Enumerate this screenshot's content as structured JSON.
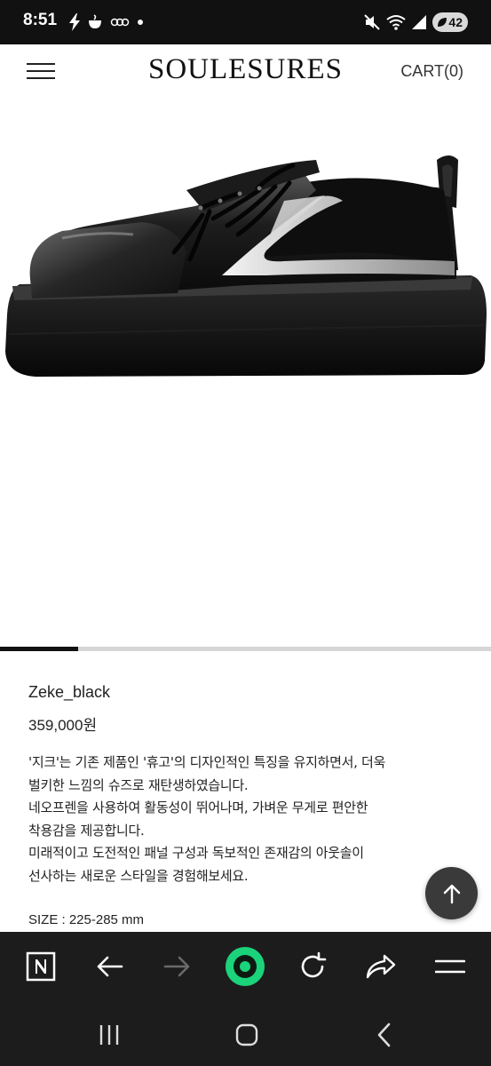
{
  "status_bar": {
    "time": "8:51",
    "battery": "42",
    "icons": [
      "bolt-icon",
      "teacup-icon",
      "link-icon",
      "dot-icon",
      "mute-icon",
      "wifi-icon",
      "signal-icon",
      "battery-icon"
    ]
  },
  "header": {
    "logo": "SOULESURES",
    "cart": "CART(0)",
    "menu_icon": "hamburger-menu-icon"
  },
  "gallery": {
    "image": "black platform shoe with silver wave accent",
    "position": 0.16
  },
  "product": {
    "name": "Zeke_black",
    "price": "359,000원",
    "description": [
      "'지크'는 기존 제품인 '휴고'의 디자인적인 특징을 유지하면서, 더욱",
      "벌키한 느낌의 슈즈로 재탄생하였습니다.",
      "네오프렌을 사용하여 활동성이 뛰어나며, 가벼운 무게로 편안한",
      "착용감을 제공합니다.",
      "미래적이고 도전적인 패널 구성과 독보적인 존재감의 아웃솔이",
      "선사하는 새로운 스타일을 경험해보세요."
    ],
    "size": "SIZE : 225-285 mm"
  },
  "scroll_top_icon": "arrow-up-icon",
  "browser_toolbar": {
    "items": [
      "naver-home-icon",
      "back-arrow-icon",
      "forward-arrow-icon",
      "green-dot-icon",
      "refresh-icon",
      "share-icon",
      "menu-icon"
    ]
  },
  "system_nav": {
    "items": [
      "recent-apps-icon",
      "home-icon",
      "back-icon"
    ]
  },
  "colors": {
    "status_bar": "#111111",
    "toolbar": "#1c1c1c",
    "green_accent": "#1bd37a",
    "text": "#222222"
  }
}
